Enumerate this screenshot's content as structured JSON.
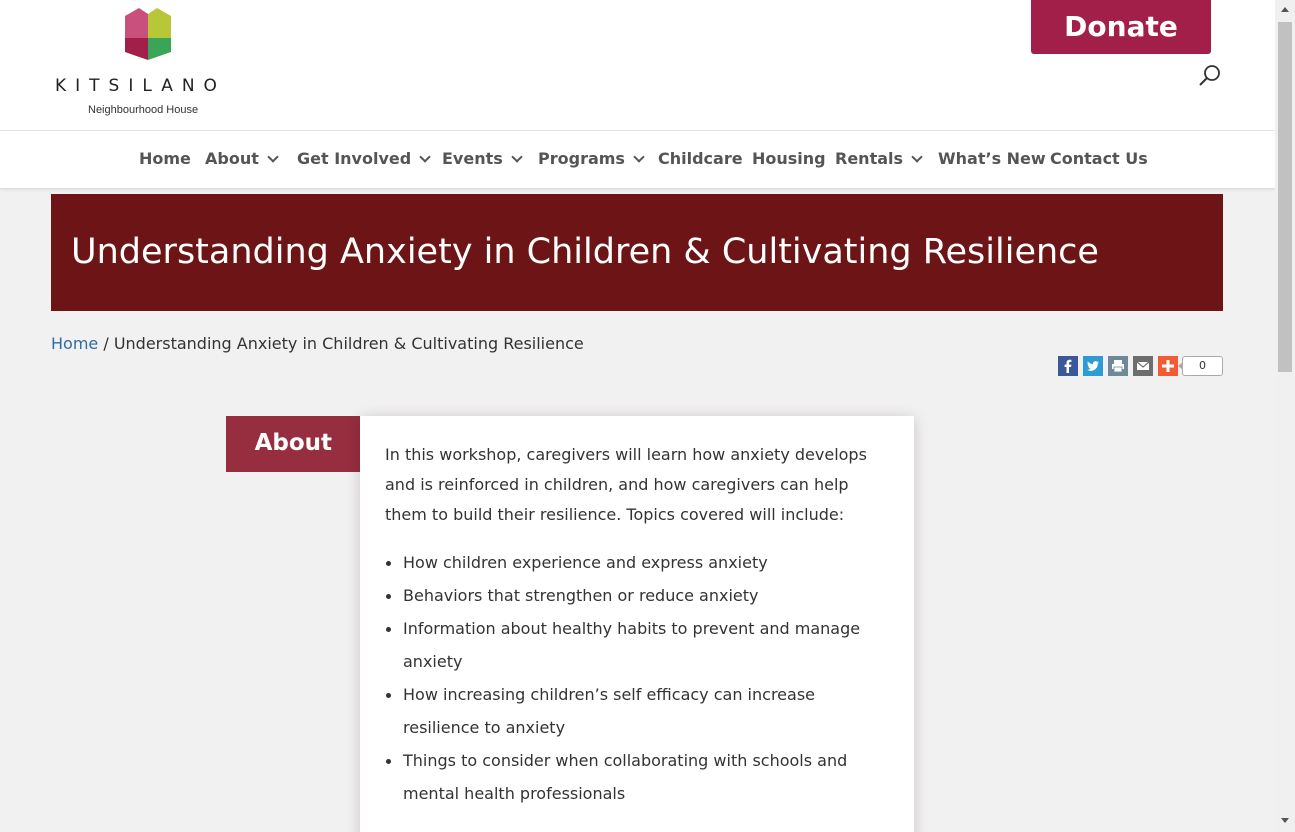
{
  "brand": {
    "name": "KITSILANO",
    "subtitle": "Neighbourhood House",
    "colors": [
      "#a11f48",
      "#c94f7c",
      "#b8c737",
      "#3aa556"
    ]
  },
  "header": {
    "donate_label": "Donate",
    "search_icon": "search-icon",
    "donate_color": "#a11f48"
  },
  "nav": {
    "items": [
      {
        "label": "Home",
        "dropdown": false
      },
      {
        "label": "About",
        "dropdown": true
      },
      {
        "label": "Get Involved",
        "dropdown": true
      },
      {
        "label": "Events",
        "dropdown": true
      },
      {
        "label": "Programs",
        "dropdown": true
      },
      {
        "label": "Childcare",
        "dropdown": false
      },
      {
        "label": "Housing",
        "dropdown": false
      },
      {
        "label": "Rentals",
        "dropdown": true
      },
      {
        "label": "What’s New",
        "dropdown": false
      },
      {
        "label": "Contact Us",
        "dropdown": false
      }
    ]
  },
  "page": {
    "title": "Understanding Anxiety in Children & Cultivating Resilience",
    "banner_color": "#6c1416"
  },
  "breadcrumb": {
    "home": "Home",
    "separator": " / ",
    "current": "Understanding Anxiety in Children & Cultivating Resilience"
  },
  "share": {
    "buttons": [
      "facebook-icon",
      "twitter-icon",
      "print-icon",
      "email-icon",
      "plus-icon"
    ],
    "count": "0"
  },
  "about": {
    "tab_label": "About",
    "intro": "In this workshop, caregivers will learn how anxiety develops and is reinforced in children, and how caregivers can help them  to build their resilience. Topics covered will include:",
    "topics": [
      "How children experience and express anxiety",
      "Behaviors that strengthen or reduce anxiety",
      "Information about healthy habits to prevent and manage anxiety",
      "How increasing children’s self efficacy can increase resilience to anxiety",
      "Things to consider when collaborating with schools and mental health professionals"
    ]
  }
}
